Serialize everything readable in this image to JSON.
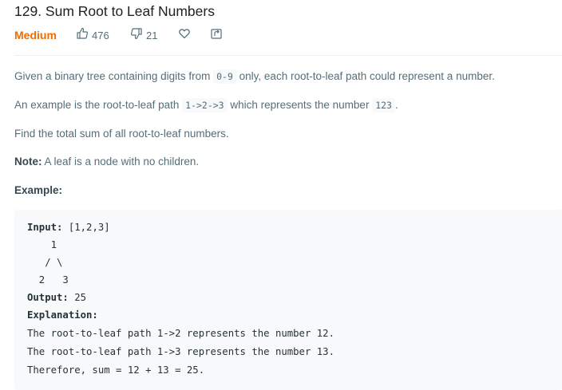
{
  "problem": {
    "title": "129. Sum Root to Leaf Numbers",
    "difficulty": "Medium",
    "likes": "476",
    "dislikes": "21"
  },
  "icons": [
    "thumbs-up-icon",
    "thumbs-down-icon",
    "heart-icon",
    "share-icon"
  ],
  "colors": {
    "difficulty": "#ef6c00",
    "example_bg": "#f7f9fa"
  },
  "description": {
    "p1_pre": "Given a binary tree containing digits from ",
    "p1_code": "0-9",
    "p1_post": " only, each root-to-leaf path could represent a number.",
    "p2_pre": "An example is the root-to-leaf path ",
    "p2_code1": "1->2->3",
    "p2_mid": " which represents the number ",
    "p2_code2": "123",
    "p2_post": ".",
    "p3": "Find the total sum of all root-to-leaf numbers.",
    "note_label": "Note:",
    "note_text": " A leaf is a node with no children.",
    "example_label": "Example:"
  },
  "example": {
    "input_label": "Input:",
    "input_value": " [1,2,3]",
    "tree_line1": "    1",
    "tree_line2": "   / \\",
    "tree_line3": "  2   3",
    "output_label": "Output:",
    "output_value": " 25",
    "explanation_label": "Explanation:",
    "line1": "The root-to-leaf path 1->2 represents the number 12.",
    "line2": "The root-to-leaf path 1->3 represents the number 13.",
    "line3": "Therefore, sum = 12 + 13 = 25."
  }
}
